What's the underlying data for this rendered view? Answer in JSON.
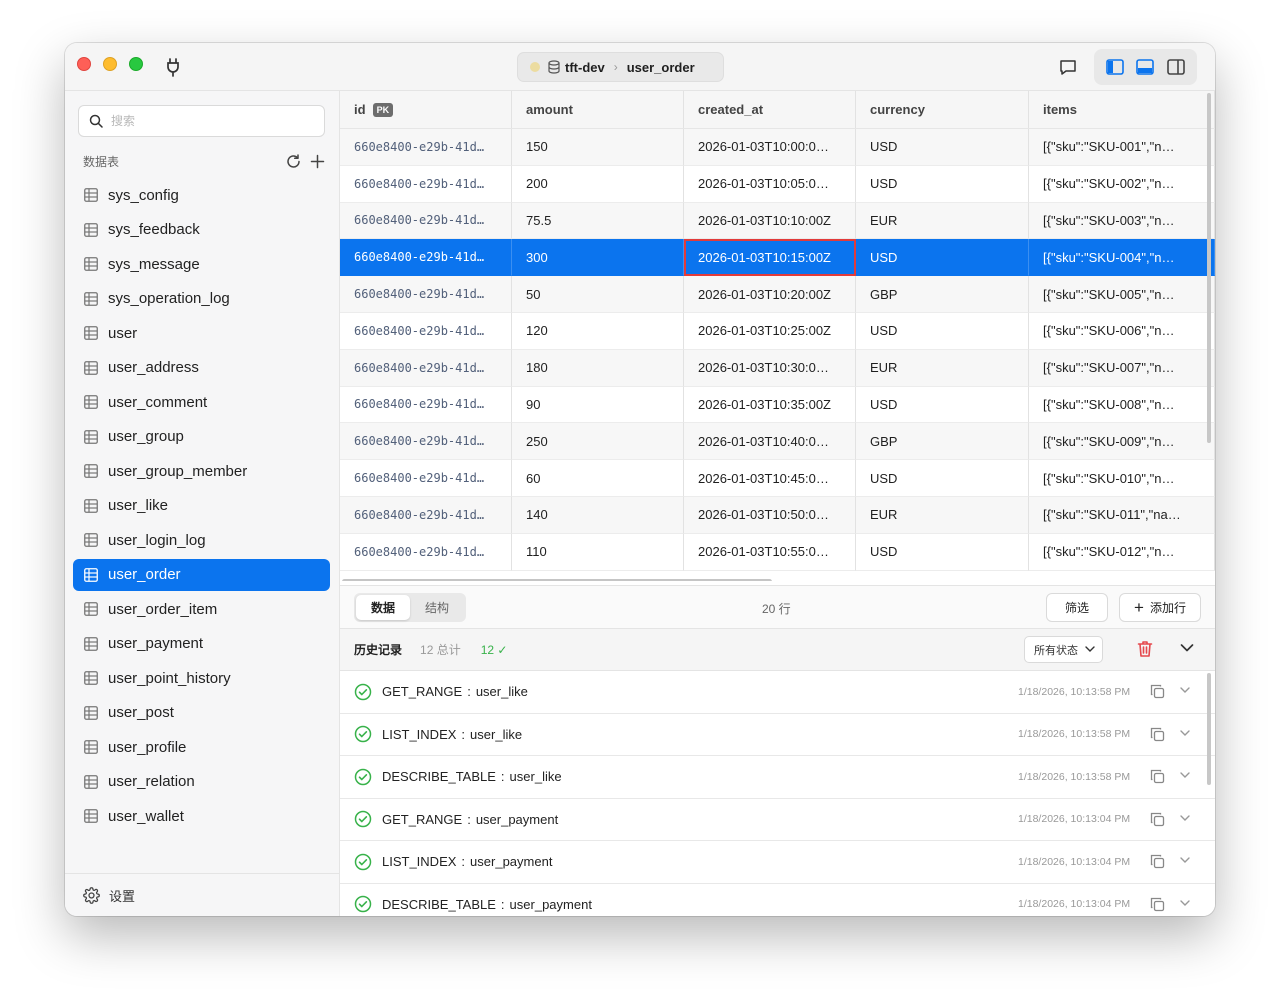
{
  "breadcrumb": {
    "connection": "tft-dev",
    "table": "user_order"
  },
  "sidebar": {
    "search_placeholder": "搜索",
    "section_label": "数据表",
    "tables": [
      "sys_config",
      "sys_feedback",
      "sys_message",
      "sys_operation_log",
      "user",
      "user_address",
      "user_comment",
      "user_group",
      "user_group_member",
      "user_like",
      "user_login_log",
      "user_order",
      "user_order_item",
      "user_payment",
      "user_point_history",
      "user_post",
      "user_profile",
      "user_relation",
      "user_wallet"
    ],
    "active_table": "user_order",
    "settings_label": "设置"
  },
  "grid": {
    "columns": [
      "id",
      "amount",
      "created_at",
      "currency",
      "items"
    ],
    "pk_badge": "PK",
    "rows": [
      [
        "660e8400-e29b-41d…",
        "150",
        "2026-01-03T10:00:0…",
        "USD",
        "[{\"sku\":\"SKU-001\",\"n…"
      ],
      [
        "660e8400-e29b-41d…",
        "200",
        "2026-01-03T10:05:0…",
        "USD",
        "[{\"sku\":\"SKU-002\",\"n…"
      ],
      [
        "660e8400-e29b-41d…",
        "75.5",
        "2026-01-03T10:10:00Z",
        "EUR",
        "[{\"sku\":\"SKU-003\",\"n…"
      ],
      [
        "660e8400-e29b-41d…",
        "300",
        "2026-01-03T10:15:00Z",
        "USD",
        "[{\"sku\":\"SKU-004\",\"n…"
      ],
      [
        "660e8400-e29b-41d…",
        "50",
        "2026-01-03T10:20:00Z",
        "GBP",
        "[{\"sku\":\"SKU-005\",\"n…"
      ],
      [
        "660e8400-e29b-41d…",
        "120",
        "2026-01-03T10:25:00Z",
        "USD",
        "[{\"sku\":\"SKU-006\",\"n…"
      ],
      [
        "660e8400-e29b-41d…",
        "180",
        "2026-01-03T10:30:0…",
        "EUR",
        "[{\"sku\":\"SKU-007\",\"n…"
      ],
      [
        "660e8400-e29b-41d…",
        "90",
        "2026-01-03T10:35:00Z",
        "USD",
        "[{\"sku\":\"SKU-008\",\"n…"
      ],
      [
        "660e8400-e29b-41d…",
        "250",
        "2026-01-03T10:40:0…",
        "GBP",
        "[{\"sku\":\"SKU-009\",\"n…"
      ],
      [
        "660e8400-e29b-41d…",
        "60",
        "2026-01-03T10:45:0…",
        "USD",
        "[{\"sku\":\"SKU-010\",\"n…"
      ],
      [
        "660e8400-e29b-41d…",
        "140",
        "2026-01-03T10:50:0…",
        "EUR",
        "[{\"sku\":\"SKU-011\",\"na…"
      ],
      [
        "660e8400-e29b-41d…",
        "110",
        "2026-01-03T10:55:0…",
        "USD",
        "[{\"sku\":\"SKU-012\",\"n…"
      ]
    ],
    "selected_row": 3,
    "focused_col": 2
  },
  "toolbar": {
    "tab_data": "数据",
    "tab_structure": "结构",
    "row_count": "20 行",
    "filter_label": "筛选",
    "add_row_label": "添加行"
  },
  "history": {
    "title": "历史记录",
    "total": "12 总计",
    "success": "12 ✓",
    "status_filter": "所有状态",
    "items": [
      {
        "op": "GET_RANGE",
        "table": "user_like",
        "time": "1/18/2026, 10:13:58 PM"
      },
      {
        "op": "LIST_INDEX",
        "table": "user_like",
        "time": "1/18/2026, 10:13:58 PM"
      },
      {
        "op": "DESCRIBE_TABLE",
        "table": "user_like",
        "time": "1/18/2026, 10:13:58 PM"
      },
      {
        "op": "GET_RANGE",
        "table": "user_payment",
        "time": "1/18/2026, 10:13:04 PM"
      },
      {
        "op": "LIST_INDEX",
        "table": "user_payment",
        "time": "1/18/2026, 10:13:04 PM"
      },
      {
        "op": "DESCRIBE_TABLE",
        "table": "user_payment",
        "time": "1/18/2026, 10:13:04 PM"
      }
    ]
  },
  "colors": {
    "accent": "#0b74ee",
    "success": "#38b24a",
    "danger": "#e5484d",
    "focus": "#e23b3b"
  }
}
